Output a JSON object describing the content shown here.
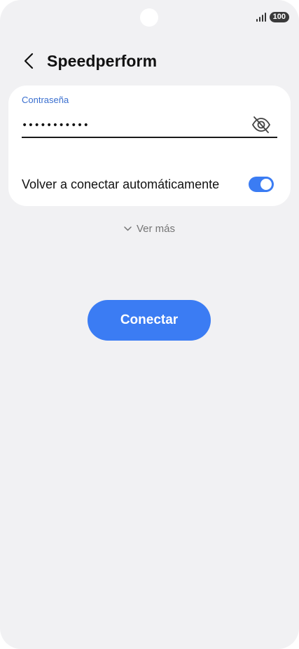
{
  "status_bar": {
    "battery_level": "100",
    "icons": [
      "signal-icon",
      "battery-icon"
    ]
  },
  "header": {
    "back_icon": "chevron-left-icon",
    "title": "Speedperform"
  },
  "form": {
    "password_label": "Contraseña",
    "password_value": "•••••••••••",
    "visibility_icon": "eye-off-icon",
    "auto_reconnect_label": "Volver a conectar automáticamente",
    "auto_reconnect_enabled": true
  },
  "more": {
    "label": "Ver más",
    "icon": "chevron-down-icon"
  },
  "actions": {
    "connect_label": "Conectar"
  },
  "colors": {
    "accent": "#3b7cf3",
    "background": "#f1f1f3",
    "card": "#ffffff",
    "label_blue": "#3a6fcf"
  }
}
